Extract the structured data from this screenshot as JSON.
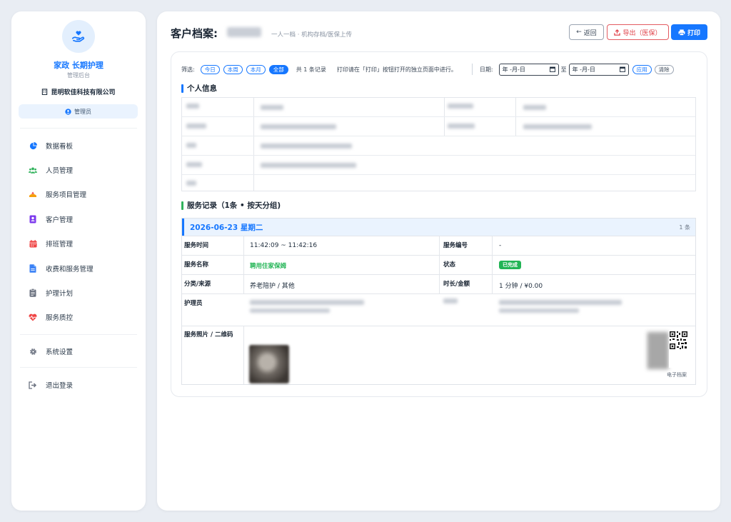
{
  "sidebar": {
    "brand_name": "家政 长期护理",
    "brand_sub": "管理后台",
    "company": "昆明软佳科技有限公司",
    "role": "管理员",
    "items": [
      {
        "label": "数据看板",
        "icon": "pie-chart-icon",
        "color": "#1677ff"
      },
      {
        "label": "人员管理",
        "icon": "users-icon",
        "color": "#31b25c"
      },
      {
        "label": "服务项目管理",
        "icon": "hand-icon",
        "color": "#f59e0b"
      },
      {
        "label": "客户管理",
        "icon": "contact-card-icon",
        "color": "#7c3aed"
      },
      {
        "label": "排班管理",
        "icon": "calendar-icon",
        "color": "#ef4444"
      },
      {
        "label": "收费和服务管理",
        "icon": "file-icon",
        "color": "#3b82f6"
      },
      {
        "label": "护理计划",
        "icon": "clipboard-icon",
        "color": "#6b7280"
      },
      {
        "label": "服务质控",
        "icon": "heart-pulse-icon",
        "color": "#ef4444"
      }
    ],
    "settings": "系统设置",
    "logout": "退出登录"
  },
  "header": {
    "title": "客户档案:",
    "subtitle": "一人一档 · 机构存档/医保上传",
    "back": "返回",
    "export": "导出（医保）",
    "print": "打印"
  },
  "filter": {
    "label": "筛选:",
    "chips": [
      "今日",
      "本周",
      "本月",
      "全部"
    ],
    "active_chip": "全部",
    "count": "共 1 条记录",
    "hint": "打印请在「打印」按钮打开的独立页面中进行。",
    "date_label": "日期:",
    "date_placeholder": "年 -月-日",
    "to": "至",
    "apply": "应用",
    "clear": "清除"
  },
  "personal_info": {
    "title": "个人信息"
  },
  "records": {
    "title": "服务记录（1条 • 按天分组)",
    "date": "2026-06-23 星期二",
    "count": "1 条",
    "rows": {
      "time_label": "服务时间",
      "time_value": "11:42:09 ~ 11:42:16",
      "number_label": "服务编号",
      "number_value": "-",
      "name_label": "服务名称",
      "name_value": "聘用住家保姆",
      "status_label": "状态",
      "status_value": "已完成",
      "category_label": "分类/来源",
      "category_value": "养老陪护 / 其他",
      "duration_label": "时长/金额",
      "duration_value": "1 分钟 / ¥0.00",
      "nurse_label": "护理员",
      "photo_label": "服务照片 / 二维码",
      "qr_caption": "电子档案"
    }
  },
  "colors": {
    "accent": "#1677ff",
    "success": "#22b455",
    "danger": "#e0424a"
  }
}
